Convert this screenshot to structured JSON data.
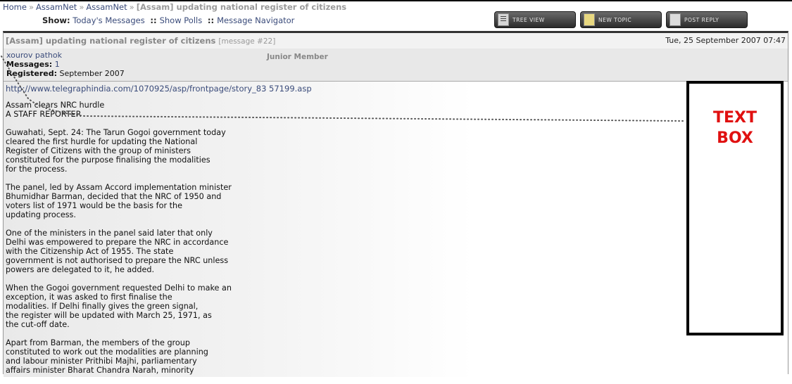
{
  "breadcrumb": {
    "home": "Home",
    "assamnet1": "AssamNet",
    "assamnet2": "AssamNet",
    "current": "[Assam] updating national register of citizens",
    "sep": "»"
  },
  "show": {
    "label": "Show:",
    "todays": "Today's Messages",
    "polls": "Show Polls",
    "navigator": "Message Navigator",
    "sep": "::"
  },
  "buttons": {
    "tree": "TREE VIEW",
    "topic": "NEW TOPIC",
    "reply": "POST REPLY"
  },
  "post": {
    "title": "[Assam] updating national register of citizens",
    "message_no": "[message #22]",
    "date": "Tue, 25 September 2007 07:47",
    "author": "xourov pathok",
    "rank": "Junior Member",
    "messages_label": "Messages:",
    "messages_value": "1",
    "registered_label": "Registered:",
    "registered_value": "September 2007",
    "url": "http://www.telegraphindia.com/1070925/asp/frontpage/story_83 57199.asp",
    "paragraphs": [
      "Assam clears NRC hurdle\nA STAFF REPORTER",
      "Guwahati, Sept. 24: The Tarun Gogoi government today\ncleared the first hurdle for updating the National\nRegister of Citizens with the group of ministers\nconstituted for the purpose finalising the modalities\nfor the process.",
      "The panel, led by Assam Accord implementation minister\nBhumidhar Barman, decided that the NRC of 1950 and\nvoters list of 1971 would be the basis for the\nupdating process.",
      "One of the ministers in the panel said later that only\nDelhi was empowered to prepare the NRC in accordance\nwith the Citizenship Act of 1955. The state\ngovernment is not authorised to prepare the NRC unless\npowers are delegated to it, he added.",
      "When the Gogoi government requested Delhi to make an\nexception, it was asked to first finalise the\nmodalities. If Delhi finally gives the green signal,\nthe register will be updated with March 25, 1971, as\nthe cut-off date.",
      "Apart from Barman, the members of the group\nconstituted to work out the modalities are planning\nand labour minister Prithibi Majhi, parliamentary\naffairs minister Bharat Chandra Narah, minority"
    ]
  },
  "textbox": {
    "text": "TEXT\nBOX",
    "color": "#e01010"
  },
  "colors": {
    "link": "#3a4b7a",
    "button_bg": "#2b2b2b"
  }
}
